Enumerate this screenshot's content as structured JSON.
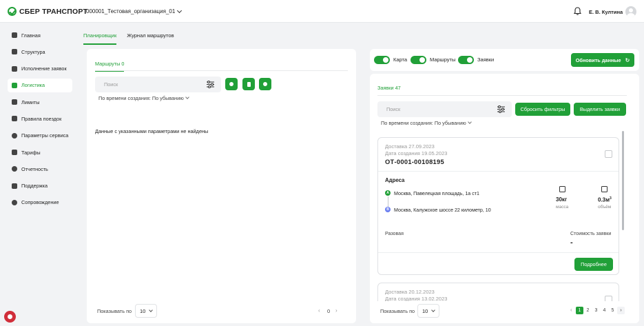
{
  "header": {
    "logo_text": "СБЕР ТРАНСПОРТ",
    "org_name": "000001_Тестовая_организация_01",
    "user_name": "Е. В. Култина"
  },
  "sidebar": {
    "items": [
      {
        "label": "Главная",
        "icon": "home-icon",
        "active": false
      },
      {
        "label": "Структура",
        "icon": "users-icon",
        "active": false
      },
      {
        "label": "Исполнение заявок",
        "icon": "truck-icon",
        "active": false
      },
      {
        "label": "Логистика",
        "icon": "route-icon",
        "active": true
      },
      {
        "label": "Лимиты",
        "icon": "limits-icon",
        "active": false
      },
      {
        "label": "Правила поездок",
        "icon": "car-icon",
        "active": false
      },
      {
        "label": "Параметры сервиса",
        "icon": "gear-icon",
        "active": false
      },
      {
        "label": "Тарифы",
        "icon": "tariff-icon",
        "active": false
      },
      {
        "label": "Отчетность",
        "icon": "report-icon",
        "active": false
      },
      {
        "label": "Поддержка",
        "icon": "chat-icon",
        "active": false
      },
      {
        "label": "Сопровождение",
        "icon": "support-icon",
        "active": false
      }
    ]
  },
  "tabs": {
    "planner": "Планировщик",
    "journal": "Журнал маршрутов"
  },
  "left": {
    "subtab": "Маршруты 0",
    "search_placeholder": "Поиск",
    "sort_label": "По времени создания: По убыванию",
    "empty_text": "Данные с указанными параметрами не найдены",
    "page_size_label": "Показывать по",
    "page_size": "10",
    "page_number": "0"
  },
  "right_top": {
    "toggles": [
      {
        "label": "Карта",
        "on": true
      },
      {
        "label": "Маршруты",
        "on": true
      },
      {
        "label": "Заявки",
        "on": true
      }
    ],
    "refresh_label": "Обновить данные"
  },
  "right": {
    "subtab": "Заявки 47",
    "search_placeholder": "Поиск",
    "reset_filters_label": "Сбросить фильтры",
    "select_requests_label": "Выделить заявки",
    "sort_label": "По времени создания: По убыванию",
    "cards": [
      {
        "delivery": "Доставка 27.09.2023",
        "created": "Дата создания 19.05.2023",
        "id": "ОТ-0001-00108195",
        "addresses_title": "Адреса",
        "from_marker": "A",
        "from_address": "Москва, Павелецкая площадь, 1а ст1",
        "to_marker": "B",
        "to_address": "Москва, Калужское шоссе 22 километр, 10",
        "mass_value": "30кг",
        "mass_label": "масса",
        "volume_value": "0.3м",
        "volume_sup": "3",
        "volume_label": "объём",
        "type": "Разовая",
        "cost_label": "Стоимость заявки",
        "cost_value": "-",
        "more_label": "Подробнее"
      },
      {
        "delivery": "Доставка 20.12.2023",
        "created": "Дата создания 13.02.2023"
      }
    ],
    "page_size_label": "Показывать по",
    "page_size": "10",
    "pages": [
      "1",
      "2",
      "3",
      "4",
      "5"
    ],
    "current_page": "1"
  },
  "colors": {
    "accent": "#21a038",
    "background": "#f2f3f5",
    "marker_b": "#6b7ff0"
  }
}
